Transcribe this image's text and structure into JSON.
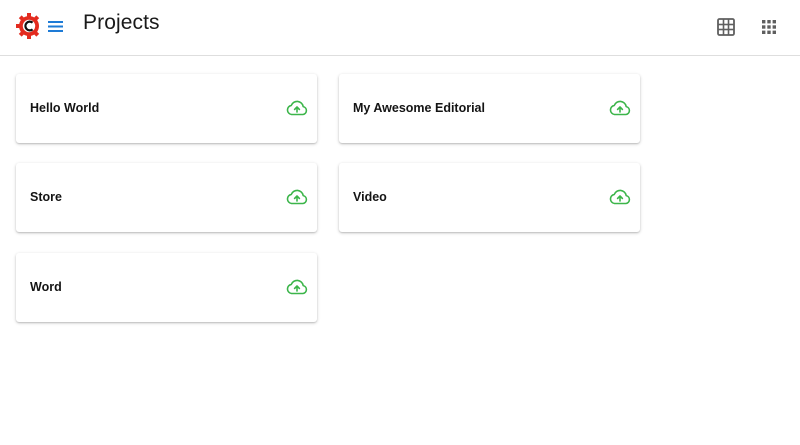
{
  "header": {
    "title": "Projects",
    "logo_icon": "c-gear-logo-icon",
    "menu_icon": "hamburger-menu-icon",
    "view_icons": [
      "table-view-icon",
      "apps-grid-icon"
    ]
  },
  "projects": [
    {
      "name": "Hello World",
      "status_icon": "cloud-upload-icon"
    },
    {
      "name": "My Awesome Editorial",
      "status_icon": "cloud-upload-icon"
    },
    {
      "name": "Store",
      "status_icon": "cloud-upload-icon"
    },
    {
      "name": "Video",
      "status_icon": "cloud-upload-icon"
    },
    {
      "name": "Word",
      "status_icon": "cloud-upload-icon"
    }
  ],
  "colors": {
    "logo_red": "#e32b1f",
    "menu_blue": "#1e7bd6",
    "upload_green": "#3cb54a",
    "icon_gray": "#5f5f5f"
  }
}
